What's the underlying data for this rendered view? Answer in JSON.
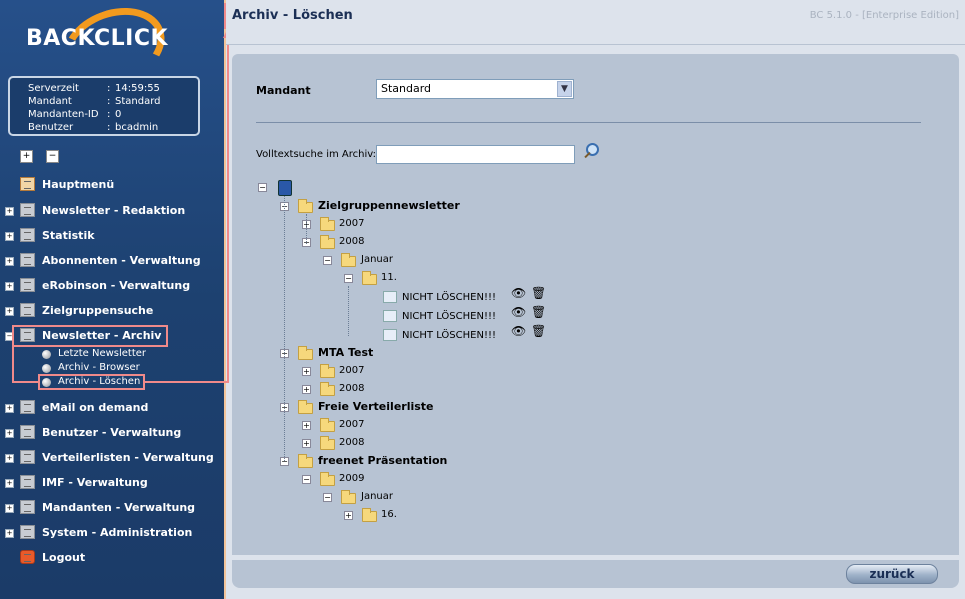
{
  "brand": {
    "logo_text": "BACKCLICK"
  },
  "info": [
    {
      "key": "Serverzeit",
      "value": "14:59:55"
    },
    {
      "key": "Mandant",
      "value": "Standard"
    },
    {
      "key": "Mandanten-ID",
      "value": "0"
    },
    {
      "key": "Benutzer",
      "value": "bcadmin"
    }
  ],
  "info_separator": ":",
  "toolbar": {
    "expand_all": "+",
    "collapse_all": "−"
  },
  "nav": [
    {
      "label": "Hauptmenü"
    },
    {
      "label": "Newsletter - Redaktion"
    },
    {
      "label": "Statistik"
    },
    {
      "label": "Abonnenten - Verwaltung"
    },
    {
      "label": "eRobinson - Verwaltung"
    },
    {
      "label": "Zielgruppensuche"
    },
    {
      "label": "Newsletter - Archiv"
    },
    {
      "label": "eMail on demand"
    },
    {
      "label": "Benutzer - Verwaltung"
    },
    {
      "label": "Verteilerlisten - Verwaltung"
    },
    {
      "label": "IMF - Verwaltung"
    },
    {
      "label": "Mandanten - Verwaltung"
    },
    {
      "label": "System - Administration"
    },
    {
      "label": "Logout"
    }
  ],
  "archiv_sub": [
    {
      "label": "Letzte Newsletter"
    },
    {
      "label": "Archiv - Browser"
    },
    {
      "label": "Archiv - Löschen"
    }
  ],
  "header": {
    "title": "Archiv - Löschen",
    "version": "BC 5.1.0 - [Enterprise Edition]"
  },
  "form": {
    "mandant_label": "Mandant",
    "mandant_value": "Standard",
    "search_label": "Volltextsuche im Archiv:",
    "search_value": ""
  },
  "tree": {
    "groups": [
      {
        "name": "Zielgruppennewsletter"
      },
      {
        "name": "MTA Test"
      },
      {
        "name": "Freie Verteilerliste"
      },
      {
        "name": "freenet Präsentation"
      }
    ],
    "years": [
      "2007",
      "2008",
      "2007",
      "2008",
      "2007",
      "2008",
      "2009"
    ],
    "months": [
      "Januar",
      "Januar"
    ],
    "days": [
      "11.",
      "16."
    ],
    "newsletters": [
      "NICHT LÖSCHEN!!!",
      "NICHT LÖSCHEN!!!",
      "NICHT LÖSCHEN!!!"
    ]
  },
  "back_button": "zurück",
  "accent": "#f08a8a"
}
